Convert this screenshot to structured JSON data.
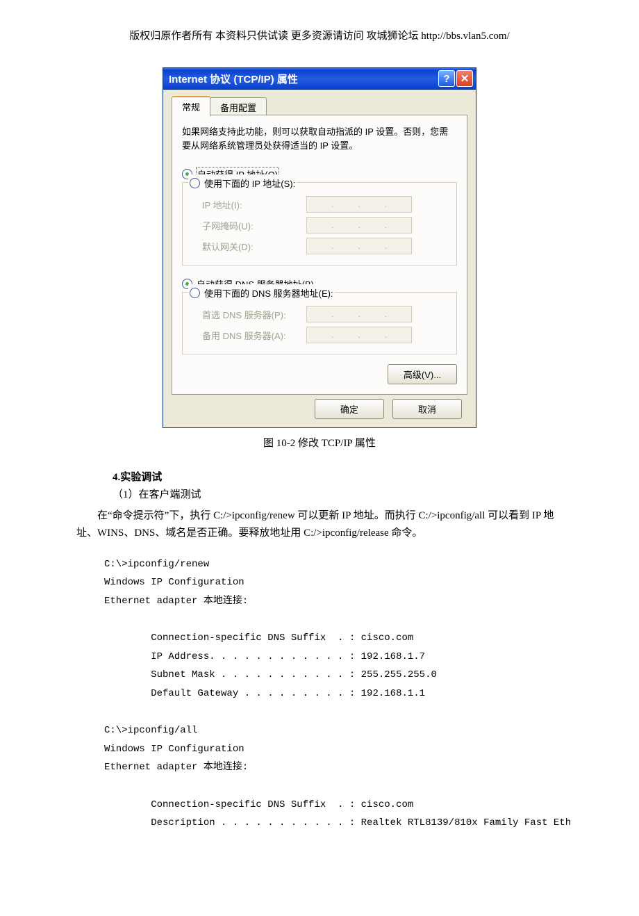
{
  "header_notice": "版权归原作者所有 本资料只供试读 更多资源请访问 攻城狮论坛 http://bbs.vlan5.com/",
  "dialog": {
    "title": "Internet 协议 (TCP/IP) 属性",
    "help_glyph": "?",
    "close_glyph": "✕",
    "tabs": {
      "general": "常规",
      "alternate": "备用配置"
    },
    "description": "如果网络支持此功能，则可以获取自动指派的 IP 设置。否则，您需要从网络系统管理员处获得适当的 IP 设置。",
    "radio_auto_ip": "自动获得 IP 地址(O)",
    "radio_manual_ip": "使用下面的 IP 地址(S):",
    "label_ip": "IP 地址(I):",
    "label_mask": "子网掩码(U):",
    "label_gateway": "默认网关(D):",
    "radio_auto_dns": "自动获得 DNS 服务器地址(B)",
    "radio_manual_dns": "使用下面的 DNS 服务器地址(E):",
    "label_dns1": "首选 DNS 服务器(P):",
    "label_dns2": "备用 DNS 服务器(A):",
    "btn_advanced": "高级(V)...",
    "btn_ok": "确定",
    "btn_cancel": "取消"
  },
  "figure_caption": "图 10-2  修改 TCP/IP 属性",
  "section_heading": "4.实验调试",
  "para_sub1": "（1）在客户端测试",
  "para_body": "在“命令提示符”下，执行 C:/>ipconfig/renew 可以更新 IP 地址。而执行 C:/>ipconfig/all 可以看到 IP 地址、WINS、DNS、域名是否正确。要释放地址用 C:/>ipconfig/release 命令。",
  "console": {
    "line1": "C:\\>ipconfig/renew",
    "line2": "Windows IP Configuration",
    "line3": "Ethernet adapter 本地连接:",
    "line4": "        Connection-specific DNS Suffix  . : cisco.com",
    "line5": "        IP Address. . . . . . . . . . . . : 192.168.1.7",
    "line6": "        Subnet Mask . . . . . . . . . . . : 255.255.255.0",
    "line7": "        Default Gateway . . . . . . . . . : 192.168.1.1",
    "line8": "C:\\>ipconfig/all",
    "line9": "Windows IP Configuration",
    "line10": "Ethernet adapter 本地连接:",
    "line11": "        Connection-specific DNS Suffix  . : cisco.com",
    "line12": "        Description . . . . . . . . . . . : Realtek RTL8139/810x Family Fast Eth"
  }
}
